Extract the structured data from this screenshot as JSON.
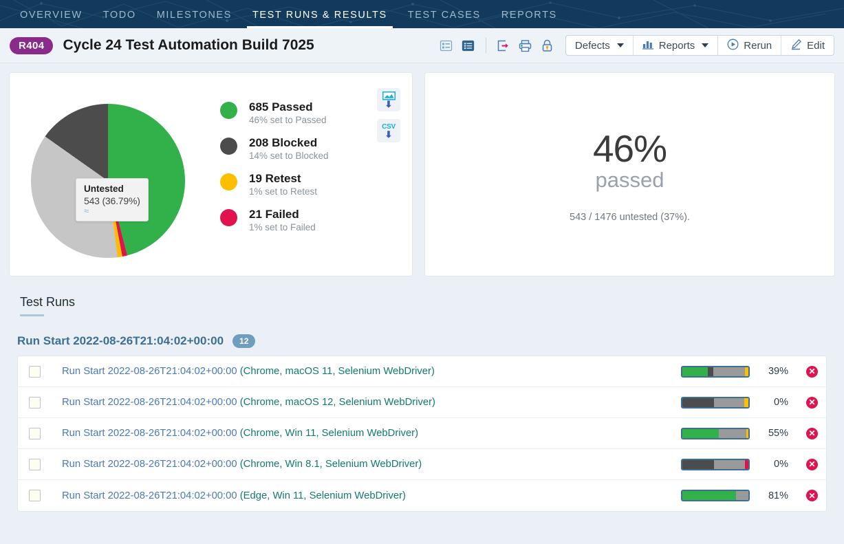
{
  "nav": {
    "tabs": [
      {
        "label": "OVERVIEW",
        "active": false
      },
      {
        "label": "TODO",
        "active": false
      },
      {
        "label": "MILESTONES",
        "active": false
      },
      {
        "label": "TEST RUNS & RESULTS",
        "active": true
      },
      {
        "label": "TEST CASES",
        "active": false
      },
      {
        "label": "REPORTS",
        "active": false
      }
    ]
  },
  "header": {
    "badge": "R404",
    "title": "Cycle 24 Test Automation Build 7025",
    "icons": [
      {
        "name": "list-view-icon",
        "state": "inactive"
      },
      {
        "name": "detail-view-icon",
        "state": "active"
      },
      {
        "name": "export-icon",
        "state": "inactive"
      },
      {
        "name": "print-icon",
        "state": "inactive"
      },
      {
        "name": "lock-icon",
        "state": "inactive"
      }
    ],
    "buttons": [
      {
        "label": "Defects",
        "icon": "",
        "caret": true
      },
      {
        "label": "Reports",
        "icon": "bar-chart-icon",
        "caret": true
      },
      {
        "label": "Rerun",
        "icon": "play-circle-icon",
        "caret": false
      },
      {
        "label": "Edit",
        "icon": "pencil-icon",
        "caret": false
      }
    ]
  },
  "chart_data": {
    "type": "pie",
    "title": "",
    "categories": [
      "Passed",
      "Blocked",
      "Untested",
      "Retest",
      "Failed"
    ],
    "values": [
      685,
      208,
      543,
      19,
      21
    ],
    "percentages": [
      46,
      14,
      36.79,
      1,
      1
    ],
    "colors": [
      "#32b14a",
      "#4c4c4c",
      "#c6c6c6",
      "#fcbf00",
      "#e0124f"
    ],
    "legend_position": "right",
    "total": 1476,
    "legend": [
      {
        "count": "685 Passed",
        "sub": "46% set to Passed",
        "color": "#32b14a"
      },
      {
        "count": "208 Blocked",
        "sub": "14% set to Blocked",
        "color": "#4c4c4c"
      },
      {
        "count": "19 Retest",
        "sub": "1% set to Retest",
        "color": "#fcbf00"
      },
      {
        "count": "21 Failed",
        "sub": "1% set to Failed",
        "color": "#e0124f"
      }
    ],
    "tooltip": {
      "title": "Untested",
      "value": "543 (36.79%)"
    },
    "downloads": [
      {
        "name": "download-image-button",
        "label": ""
      },
      {
        "name": "download-csv-button",
        "label": "CSV"
      }
    ]
  },
  "summary": {
    "percent": "46%",
    "label": "passed",
    "note": "543 / 1476 untested (37%)."
  },
  "runs_section": {
    "title": "Test Runs",
    "group_label": "Run Start 2022-08-26T21:04:02+00:00",
    "group_count": "12",
    "rows": [
      {
        "date": "Run Start 2022-08-26T21:04:02+00:00 ",
        "env": "(Chrome, macOS 11, Selenium WebDriver)",
        "percent": "39%",
        "bar": [
          {
            "color": "#32b14a",
            "width": 39
          },
          {
            "color": "#4c4c4c",
            "width": 8
          },
          {
            "color": "#9a9a9a",
            "width": 48
          },
          {
            "color": "#fcbf00",
            "width": 5
          }
        ]
      },
      {
        "date": "Run Start 2022-08-26T21:04:02+00:00 ",
        "env": "(Chrome, macOS 12, Selenium WebDriver)",
        "percent": "0%",
        "bar": [
          {
            "color": "#4c4c4c",
            "width": 48
          },
          {
            "color": "#9a9a9a",
            "width": 46
          },
          {
            "color": "#fcbf00",
            "width": 6
          }
        ]
      },
      {
        "date": "Run Start 2022-08-26T21:04:02+00:00 ",
        "env": "(Chrome, Win 11, Selenium WebDriver)",
        "percent": "55%",
        "bar": [
          {
            "color": "#32b14a",
            "width": 55
          },
          {
            "color": "#9a9a9a",
            "width": 42
          },
          {
            "color": "#fcbf00",
            "width": 3
          }
        ]
      },
      {
        "date": "Run Start 2022-08-26T21:04:02+00:00 ",
        "env": "(Chrome, Win 8.1, Selenium WebDriver)",
        "percent": "0%",
        "bar": [
          {
            "color": "#4c4c4c",
            "width": 48
          },
          {
            "color": "#9a9a9a",
            "width": 47
          },
          {
            "color": "#e0124f",
            "width": 5
          }
        ]
      },
      {
        "date": "Run Start 2022-08-26T21:04:02+00:00 ",
        "env": "(Edge, Win 11, Selenium WebDriver)",
        "percent": "81%",
        "bar": [
          {
            "color": "#32b14a",
            "width": 81
          },
          {
            "color": "#9a9a9a",
            "width": 19
          }
        ]
      }
    ]
  },
  "colors": {
    "nav_bg": "#123a5c",
    "accent": "#4a7ab5",
    "passed": "#32b14a",
    "blocked": "#4c4c4c",
    "untested": "#c6c6c6",
    "retest": "#fcbf00",
    "failed": "#e0124f",
    "badge": "#8a2a8a"
  }
}
